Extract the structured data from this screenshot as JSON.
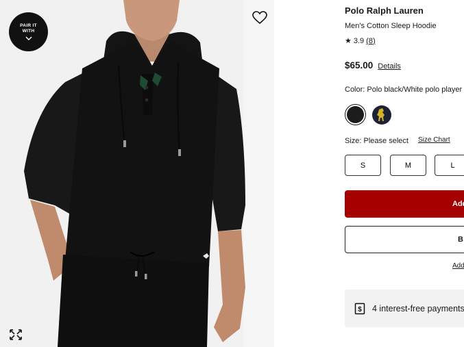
{
  "gallery": {
    "pair_with_label": "PAIR IT WITH",
    "icons": {
      "favorite": "heart-icon",
      "pair_toggle": "chevron-down-icon",
      "expand": "expand-icon"
    }
  },
  "product": {
    "brand": "Polo Ralph Lauren",
    "name": "Men's Cotton Sleep Hoodie",
    "rating": "3.9",
    "review_count": "(8)",
    "price": "$65.00",
    "details_link": "Details",
    "color_label": "Color: Polo black/White polo player",
    "color_swatches": [
      "black",
      "navy-with-gold-pony"
    ],
    "size_label": "Size: Please select",
    "size_chart_link": "Size Chart",
    "sizes": [
      "S",
      "M",
      "L"
    ],
    "add_to_bag_label": "Add",
    "buy_now_label": "B",
    "add_link": "Add",
    "installments_text": "4 interest-free payments"
  },
  "colors": {
    "accent_red": "#a50000",
    "swatch_black": "#1c1c1c",
    "swatch_navy": "#1b2233",
    "pony_gold": "#d4b227"
  }
}
